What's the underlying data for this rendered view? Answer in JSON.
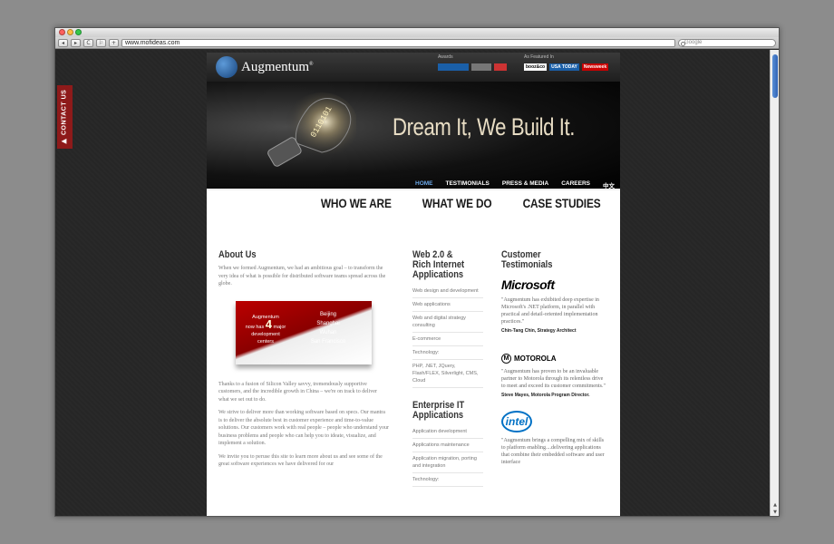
{
  "browser": {
    "url": "www.mofideas.com",
    "search_placeholder": "Google",
    "back_icon": "◂",
    "forward_icon": "▸",
    "reload_icon": "C",
    "bookmark_icon": "⚐",
    "add_icon": "+"
  },
  "sidebar": {
    "contact_label": "▶ CONTACT US"
  },
  "header": {
    "logo_text": "Augmentum",
    "logo_reg": "®",
    "awards_label": "Awards",
    "featured_label": "As Featured In",
    "featured_badges": [
      "booz&co",
      "USA TODAY",
      "Newsweek"
    ]
  },
  "hero": {
    "slogan": "Dream It, We Build It.",
    "nav": [
      "HOME",
      "TESTIMONIALS",
      "PRESS & MEDIA",
      "CAREERS",
      "中文"
    ]
  },
  "megamenu": [
    "WHO WE ARE",
    "WHAT WE DO",
    "CASE STUDIES"
  ],
  "about": {
    "title": "About Us",
    "intro": "When we formed Augmentum, we had an ambitious goal – to transform the very idea of what is possible for distributed software teams spread across the globe.",
    "slide": {
      "line1": "Augmentum",
      "line2": "now has",
      "number": "4",
      "line3": "major",
      "line4": "development",
      "line5": "centers",
      "cities": [
        "Beijing",
        "Shanghai",
        "Wuhan",
        "San Francisco"
      ]
    },
    "p2": "Thanks to a fusion of Silicon Valley savvy, tremendously supportive customers, and the incredible growth in China – we're on track to deliver what we set out to do.",
    "p3": "We strive to deliver more than working software based on specs. Our mantra is to deliver the absolute best in customer experience and time-to-value solutions. Our customers work with real people – people who understand your business problems and people who can help you to ideate, visualize, and implement a solution.",
    "p4": "We invite you to peruse this site to learn more about us and see some of the great software experiences we have delivered for our"
  },
  "web": {
    "title": "Web 2.0 & Rich Internet Applications",
    "items": [
      "Web design and development",
      "Web applications",
      "Web and digital strategy consulting",
      "E-commerce",
      "Technology:",
      "PHP, .NET, JQuery, Flash/FLEX, Silverlight, CMS, Cloud"
    ],
    "title2": "Enterprise IT Applications",
    "items2": [
      "Application development",
      "Applications maintenance",
      "Application migration, porting and integration",
      "Technology:"
    ]
  },
  "testimonials": {
    "title": "Customer Testimonials",
    "items": [
      {
        "company": "Microsoft",
        "quote": "\"Augmentum has exhibited deep expertise in Microsoft's .NET platform, in parallel with practical and detail-oriented implementation practices.\"",
        "by": "Chin-Tang Chin, Strategy Architect"
      },
      {
        "company": "MOTOROLA",
        "quote": "\"Augmentum has proven to be an invaluable partner to Motorola through its relentless drive to meet and exceed its customer commitments.\"",
        "by": "Steve Mayes, Motorola Program Director."
      },
      {
        "company": "intel",
        "quote": "\"Augmentum brings a compelling mix of skills to platform enabling....delivering applications that combine their embedded software and user interface",
        "by": ""
      }
    ]
  },
  "colors": {
    "accent_blue": "#6aa6e6",
    "contact_red": "#8e1a1a",
    "slogan": "#e8ddc4"
  }
}
